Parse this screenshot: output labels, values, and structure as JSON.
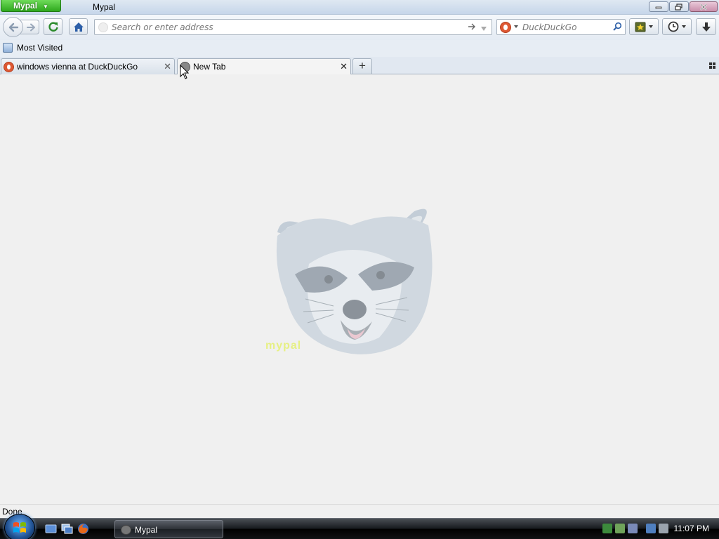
{
  "window": {
    "app_button_label": "Mypal",
    "title": "Mypal"
  },
  "navbar": {
    "url_placeholder": "Search or enter address",
    "search_placeholder": "DuckDuckGo"
  },
  "bookmarks": {
    "items": [
      {
        "label": "Most Visited",
        "icon": "folder-icon"
      }
    ]
  },
  "tabs": [
    {
      "label": "windows vienna at DuckDuckGo",
      "icon": "duckduckgo-favicon",
      "selected": false
    },
    {
      "label": "New Tab",
      "icon": "newtab-favicon",
      "selected": true
    }
  ],
  "content": {
    "watermark_text": "mypal",
    "image": "raccoon-logo"
  },
  "statusbar": {
    "text": "Done"
  },
  "taskbar": {
    "tasks": [
      {
        "label": "Mypal",
        "active": true
      }
    ],
    "clock": "11:07 PM"
  },
  "colors": {
    "app_button": "#2ea81d",
    "titlebar": "#c6d6ea",
    "content_bg": "#f0f0f0",
    "taskbar": "#15181c",
    "close_button": "#c98fab"
  }
}
